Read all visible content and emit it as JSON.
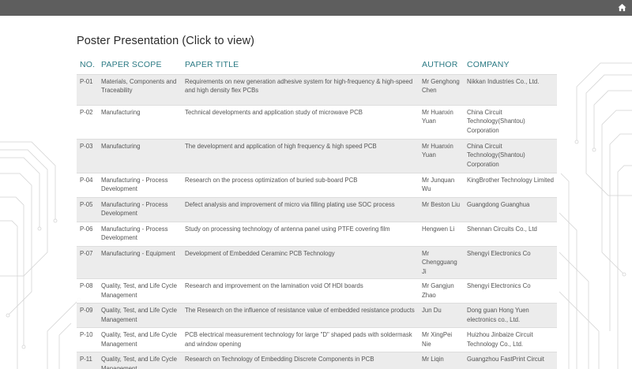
{
  "header": {
    "home_icon": "home-icon"
  },
  "page": {
    "title": "Poster Presentation (Click to view)"
  },
  "table": {
    "headers": {
      "no": "NO.",
      "scope": "PAPER SCOPE",
      "title": "PAPER TITLE",
      "author": "AUTHOR",
      "company": "COMPANY"
    },
    "rows": [
      {
        "no": "P-01",
        "scope": "Materials, Components and Traceability",
        "title": "Requirements on new generation adhesive system for high-frequency & high-speed and high density flex PCBs",
        "author": "Mr Genghong Chen",
        "company": "Nikkan Industries Co., Ltd."
      },
      {
        "no": "P-02",
        "scope": "Manufacturing",
        "title": "Technical developments and application study of microwave PCB",
        "author": "Mr Huanxin Yuan",
        "company": "China Circuit Technology(Shantou) Corporation"
      },
      {
        "no": "P-03",
        "scope": "Manufacturing",
        "title": "The development and application of high frequency & high speed PCB",
        "author": "Mr Huanxin Yuan",
        "company": "China Circuit Technology(Shantou) Corporation"
      },
      {
        "no": "P-04",
        "scope": "Manufacturing - Process Development",
        "title": "Research on the process optimization of buried sub-board PCB",
        "author": "Mr Junquan Wu",
        "company": "KingBrother Technology Limited"
      },
      {
        "no": "P-05",
        "scope": "Manufacturing - Process Development",
        "title": "Defect analysis and improvement of micro via filling plating use SOC process",
        "author": "Mr Beston Liu",
        "company": "Guangdong Guanghua"
      },
      {
        "no": "P-06",
        "scope": "Manufacturing - Process Development",
        "title": "Study on processing technology of antenna panel using PTFE covering film",
        "author": "Hengwen Li",
        "company": "Shennan Circuits Co., Ltd"
      },
      {
        "no": "P-07",
        "scope": "Manufacturing - Equipment",
        "title": "Development of Embedded Ceraminc PCB Technology",
        "author": "Mr Chengguang Ji",
        "company": "Shengyi Electronics Co"
      },
      {
        "no": "P-08",
        "scope": "Quality, Test, and Life Cycle Management",
        "title": "Research and improvement on the lamination void Of HDI boards",
        "author": "Mr Gangjun Zhao",
        "company": "Shengyi Electronics Co"
      },
      {
        "no": "P-09",
        "scope": "Quality, Test, and Life Cycle Management",
        "title": "The Research on the influence of resistance value of embedded resistance products",
        "author": "Jun Du",
        "company": "Dong guan Hong Yuen electronics co., Ltd."
      },
      {
        "no": "P-10",
        "scope": "Quality, Test, and Life Cycle Management",
        "title": "PCB electrical measurement technology for large \"D\" shaped pads with soldermask and window opening",
        "author": "Mr XingPei Nie",
        "company": "Huizhou Jinbaize Circuit Technology Co., Ltd."
      },
      {
        "no": "P-11",
        "scope": "Quality, Test, and Life Cycle Management",
        "title": "Research on Technology of Embedding Discrete Components in PCB",
        "author": "Mr Liqin",
        "company": "Guangzhou FastPrint Circuit"
      }
    ]
  },
  "colors": {
    "topbar": "#5e5e5e",
    "header_text": "#2c7a84",
    "row_alt": "#ececec"
  }
}
